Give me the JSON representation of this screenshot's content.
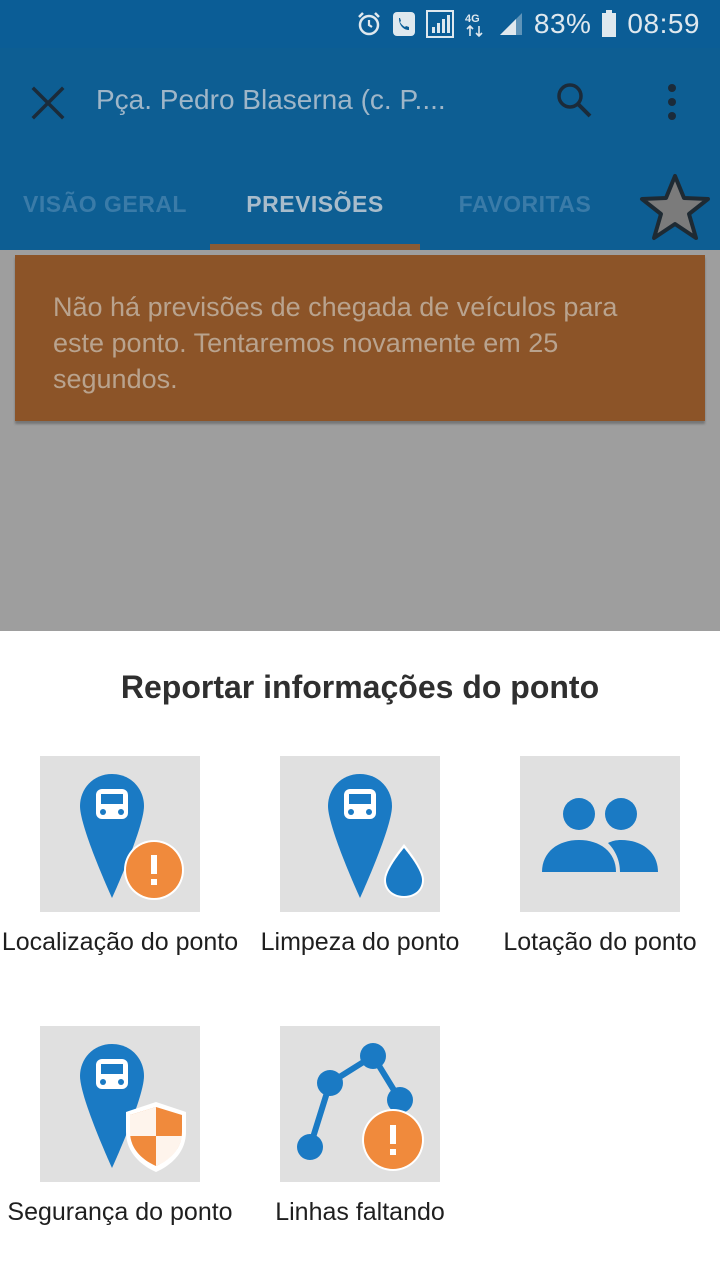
{
  "status_bar": {
    "battery": "83%",
    "time": "08:59",
    "icons": [
      "alarm-icon",
      "call-icon",
      "signal-icon",
      "4g-icon",
      "signal-bars-icon",
      "battery-icon"
    ]
  },
  "app_bar": {
    "title": "Pça. Pedro Blaserna (c. P....",
    "icons": [
      "close-icon",
      "search-icon",
      "more-vert-icon"
    ]
  },
  "tabs": [
    {
      "label": "VISÃO GERAL",
      "selected": false
    },
    {
      "label": "PREVISÕES",
      "selected": true
    },
    {
      "label": "FAVORITAS",
      "selected": false
    }
  ],
  "favorite_icon": "star-icon",
  "warning": {
    "text": "Não há previsões de chegada de veículos para este ponto. Tentaremos novamente em 25 segundos."
  },
  "sheet": {
    "title": "Reportar informações do ponto",
    "options": [
      {
        "label": "Localização do ponto",
        "icon": "bus-location-alert-icon"
      },
      {
        "label": "Limpeza do ponto",
        "icon": "bus-location-cleaning-icon"
      },
      {
        "label": "Lotação do ponto",
        "icon": "people-icon"
      },
      {
        "label": "Segurança do ponto",
        "icon": "bus-location-security-icon"
      },
      {
        "label": "Linhas faltando",
        "icon": "route-alert-icon"
      }
    ]
  },
  "colors": {
    "primary": "#0d5e93",
    "status_bar": "#0b5d96",
    "accent_blue": "#1a7ac4",
    "alert_orange": "#f08a3c",
    "warning_bg": "#8c5428"
  }
}
